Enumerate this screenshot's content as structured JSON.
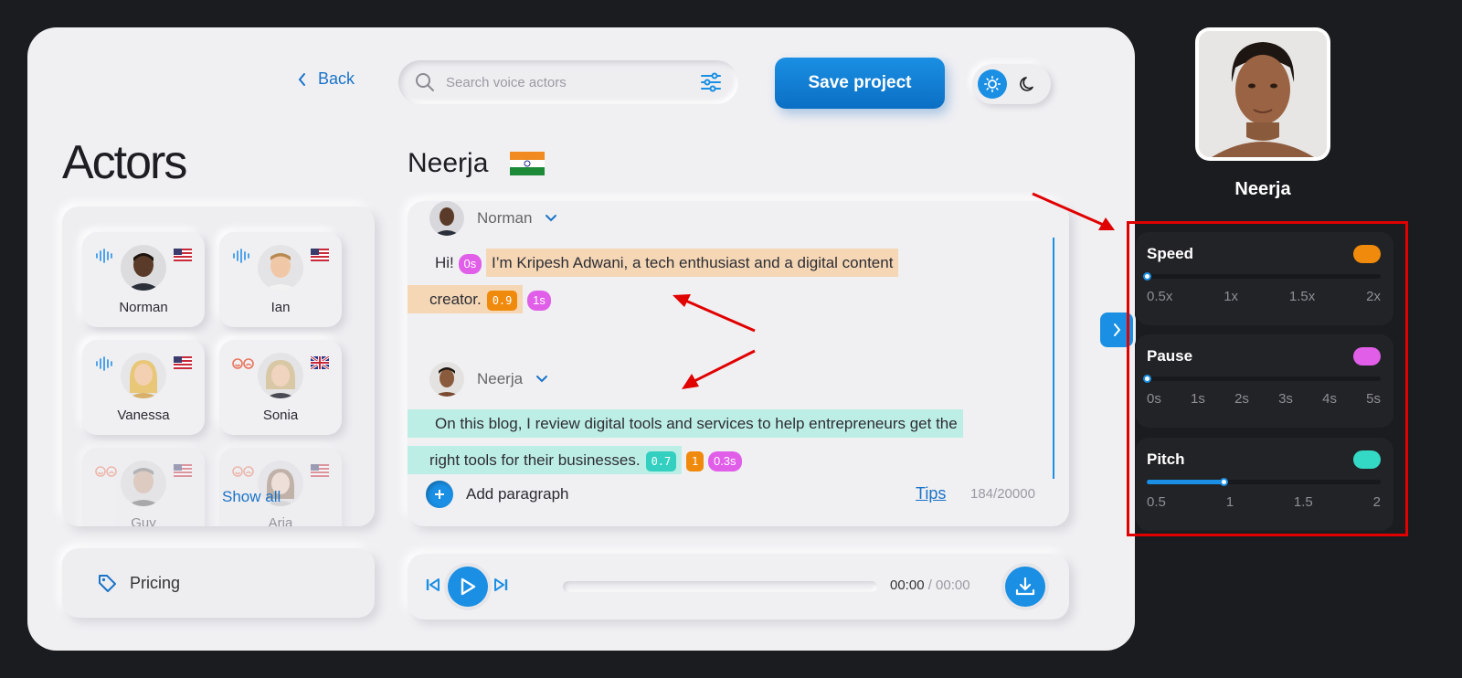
{
  "header": {
    "back_label": "Back",
    "search_placeholder": "Search voice actors",
    "save_label": "Save project"
  },
  "sidebar": {
    "title": "Actors",
    "actors": [
      {
        "name": "Norman",
        "tag": "waveform-icon",
        "flag": "us-flag"
      },
      {
        "name": "Ian",
        "tag": "waveform-icon",
        "flag": "us-flag"
      },
      {
        "name": "Vanessa",
        "tag": "waveform-icon",
        "flag": "us-flag"
      },
      {
        "name": "Sonia",
        "tag": "mask-icon",
        "flag": "uk-flag"
      },
      {
        "name": "Guy",
        "tag": "mask-icon",
        "flag": "us-flag"
      },
      {
        "name": "Aria",
        "tag": "mask-icon",
        "flag": "us-flag"
      }
    ],
    "show_all_label": "Show all",
    "pricing_label": "Pricing"
  },
  "editor": {
    "actor_name": "Neerja",
    "blocks": [
      {
        "speaker": "Norman",
        "pre_text": "Hi!",
        "pause_chip_1": "0s",
        "highlight_1": "I’m Kripesh Adwani, a tech enthusiast and a digital content",
        "highlight_2": "creator.",
        "speed_chip": "0.9",
        "pause_chip_2": "1s"
      },
      {
        "speaker": "Neerja",
        "highlight_1": "On this blog, I review digital tools and services to help entrepreneurs get the",
        "highlight_2": "right tools for their businesses.",
        "pitch_chip": "0.7",
        "speed_chip": "1",
        "pause_chip": "0.3s"
      }
    ],
    "add_paragraph_label": "Add paragraph",
    "tips_label": "Tips",
    "char_count": "184/20000"
  },
  "player": {
    "current_time": "00:00",
    "total_time": "/ 00:00",
    "progress": 0
  },
  "voice_panel": {
    "name": "Neerja",
    "settings": [
      {
        "title": "Speed",
        "color": "#f08a0c",
        "ticks": [
          "0.5x",
          "1x",
          "1.5x",
          "2x"
        ],
        "value_fraction": 0.0
      },
      {
        "title": "Pause",
        "color": "#e05ee8",
        "ticks": [
          "0s",
          "1s",
          "2s",
          "3s",
          "4s",
          "5s"
        ],
        "value_fraction": 0.0
      },
      {
        "title": "Pitch",
        "color": "#33d9c4",
        "ticks": [
          "0.5",
          "1",
          "1.5",
          "2"
        ],
        "value_fraction": 0.33
      }
    ]
  },
  "colors": {
    "accent": "#1a8fe3",
    "annotation": "#e00000",
    "highlight_orange": "#f5d7b6",
    "highlight_teal": "#bdeee6"
  }
}
